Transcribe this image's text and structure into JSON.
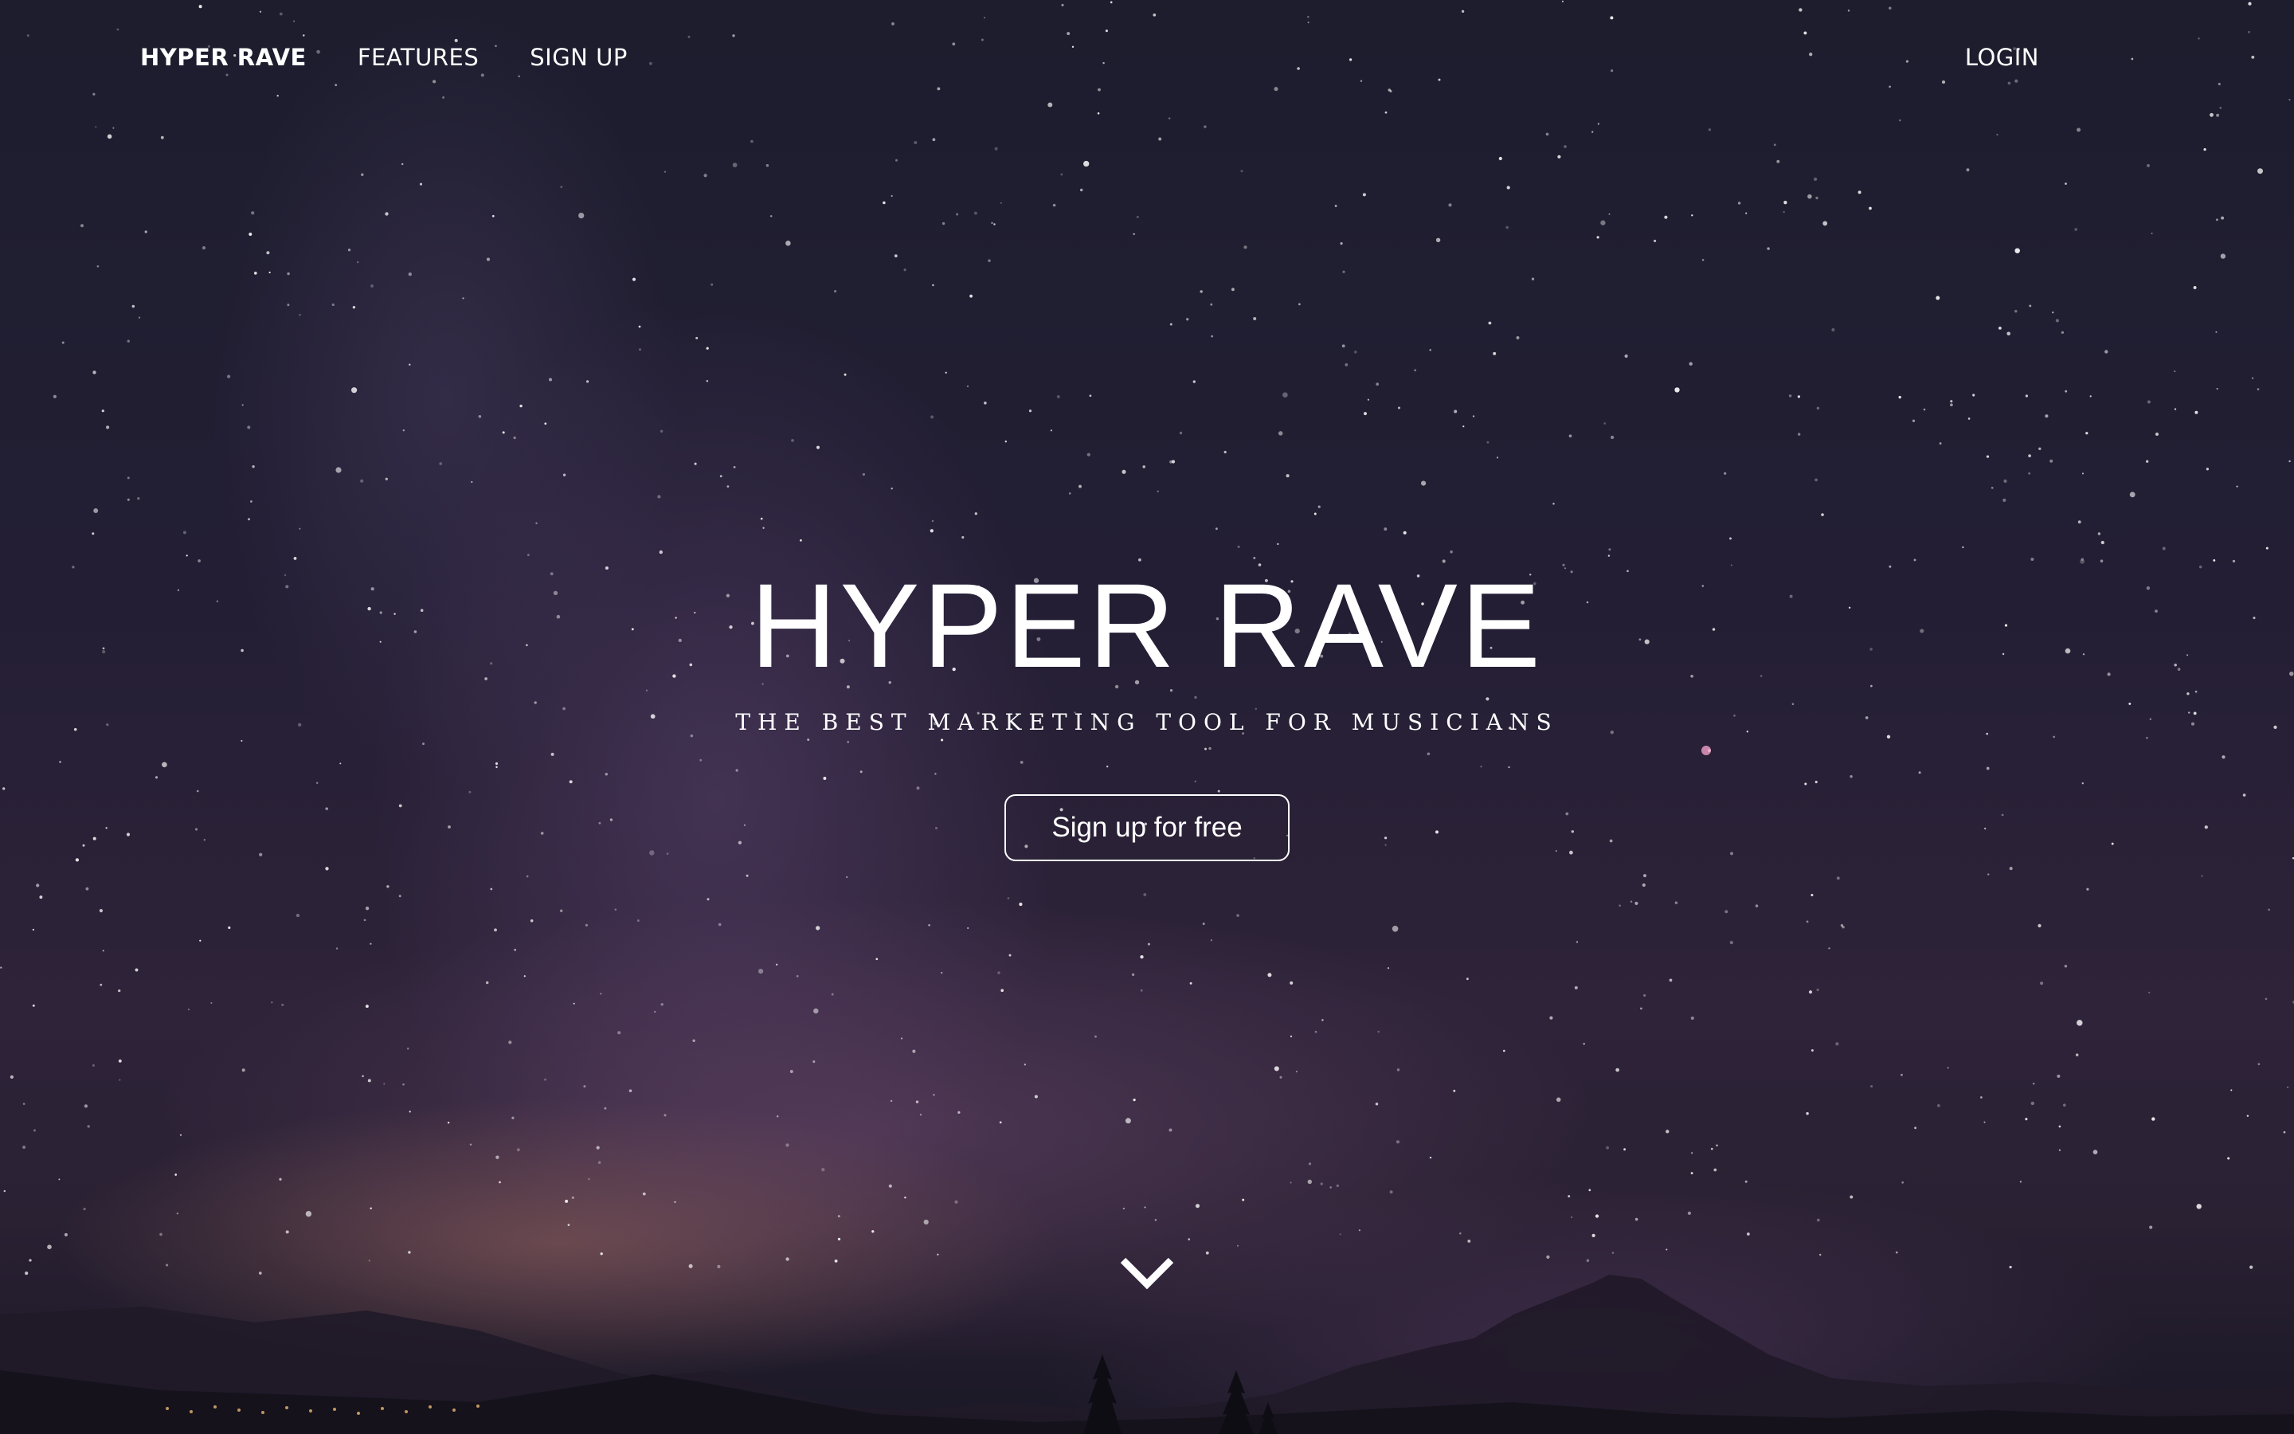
{
  "navbar": {
    "brand": "HYPER RAVE",
    "features": "FEATURES",
    "signup": "SIGN UP",
    "login": "LOGIN"
  },
  "hero": {
    "title": "HYPER RAVE",
    "subtitle": "THE BEST MARKETING TOOL FOR MUSICIANS",
    "cta": "Sign up for free",
    "scroll_icon": "chevron-down-icon"
  },
  "colors": {
    "text": "#ffffff",
    "sky_top": "#1d1d2e",
    "sky_mid": "#2e2339",
    "glow": "#96645f"
  }
}
